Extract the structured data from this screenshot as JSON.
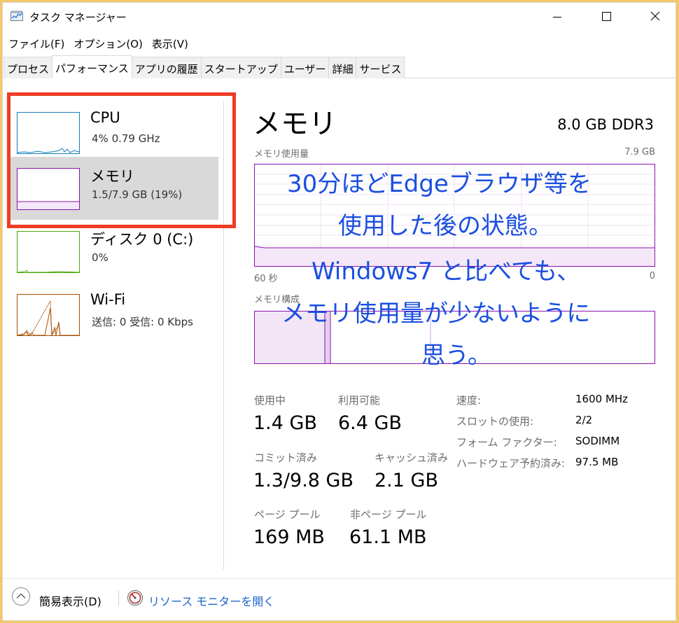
{
  "window": {
    "title": "タスク マネージャー"
  },
  "menu": [
    "ファイル(F)",
    "オプション(O)",
    "表示(V)"
  ],
  "tabs": [
    "プロセス",
    "パフォーマンス",
    "アプリの履歴",
    "スタートアップ",
    "ユーザー",
    "詳細",
    "サービス"
  ],
  "active_tab": "パフォーマンス",
  "resources": [
    {
      "name": "CPU",
      "detail": "4%  0.79 GHz",
      "color": "#117dbb"
    },
    {
      "name": "メモリ",
      "detail": "1.5/7.9 GB (19%)",
      "color": "#8b12ae"
    },
    {
      "name": "ディスク 0 (C:)",
      "detail": "0%",
      "color": "#4da60c"
    },
    {
      "name": "Wi-Fi",
      "detail": "送信: 0  受信: 0 Kbps",
      "color": "#a74f01"
    }
  ],
  "selected_resource": "メモリ",
  "memory": {
    "title": "メモリ",
    "spec": "8.0 GB DDR3",
    "usage_label": "メモリ使用量",
    "usage_max": "7.9 GB",
    "time_left": "60 秒",
    "time_right": "0",
    "composition_label": "メモリ構成",
    "usage_fraction": 0.19,
    "stats": {
      "in_use_label": "使用中",
      "in_use": "1.4 GB",
      "available_label": "利用可能",
      "available": "6.4 GB",
      "committed_label": "コミット済み",
      "committed": "1.3/9.8 GB",
      "cached_label": "キャッシュ済み",
      "cached": "2.1 GB",
      "paged_pool_label": "ページ プール",
      "paged_pool": "169 MB",
      "nonpaged_pool_label": "非ページ プール",
      "nonpaged_pool": "61.1 MB"
    },
    "specs": [
      {
        "label": "速度:",
        "value": "1600 MHz"
      },
      {
        "label": "スロットの使用:",
        "value": "2/2"
      },
      {
        "label": "フォーム ファクター:",
        "value": "SODIMM"
      },
      {
        "label": "ハードウェア予約済み:",
        "value": "97.5 MB"
      }
    ]
  },
  "annotation": {
    "lines": [
      "30分ほどEdgeブラウザ等を",
      "使用した後の状態。",
      "Windows7 と比べても、",
      "メモリ使用量が少ないように",
      "思う。"
    ],
    "color": "#1a4fe0"
  },
  "footer": {
    "fewer_details": "簡易表示(D)",
    "resource_monitor": "リソース モニターを開く"
  },
  "highlight_color": "#ee3c26"
}
